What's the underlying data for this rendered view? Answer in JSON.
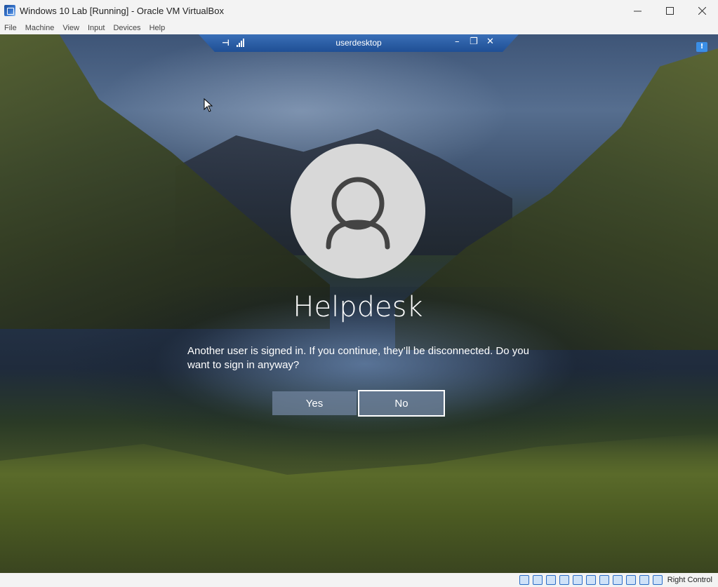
{
  "window": {
    "title": "Windows 10 Lab [Running] - Oracle VM VirtualBox",
    "app_icon": "virtualbox-icon",
    "controls": [
      "minimize-icon",
      "maximize-icon",
      "close-icon"
    ]
  },
  "menubar": {
    "items": [
      {
        "label": "File"
      },
      {
        "label": "Machine"
      },
      {
        "label": "View"
      },
      {
        "label": "Input"
      },
      {
        "label": "Devices"
      },
      {
        "label": "Help"
      }
    ]
  },
  "rdp_bar": {
    "title": "userdesktop",
    "pin_icon": "pin-icon",
    "signal_icon": "connection-signal-icon",
    "minimize": "–",
    "restore": "❐",
    "close": "✕"
  },
  "signin": {
    "username": "Helpdesk",
    "message": "Another user is signed in. If you continue, they’ll be disconnected. Do you want to sign in anyway?",
    "yes_label": "Yes",
    "no_label": "No"
  },
  "statusbar": {
    "icons": [
      "hard-disk-icon",
      "optical-drive-icon",
      "audio-icon",
      "network-icon",
      "usb-icon",
      "shared-folder-icon",
      "display-icon",
      "video-capture-icon",
      "cpu-icon",
      "mouse-integration-icon",
      "keyboard-icon"
    ],
    "host_key_label": "Right Control"
  },
  "colors": {
    "rdp_bar": "#1f4f95",
    "button_bg": "#6e829b",
    "avatar_bg": "#d8d8d8"
  }
}
